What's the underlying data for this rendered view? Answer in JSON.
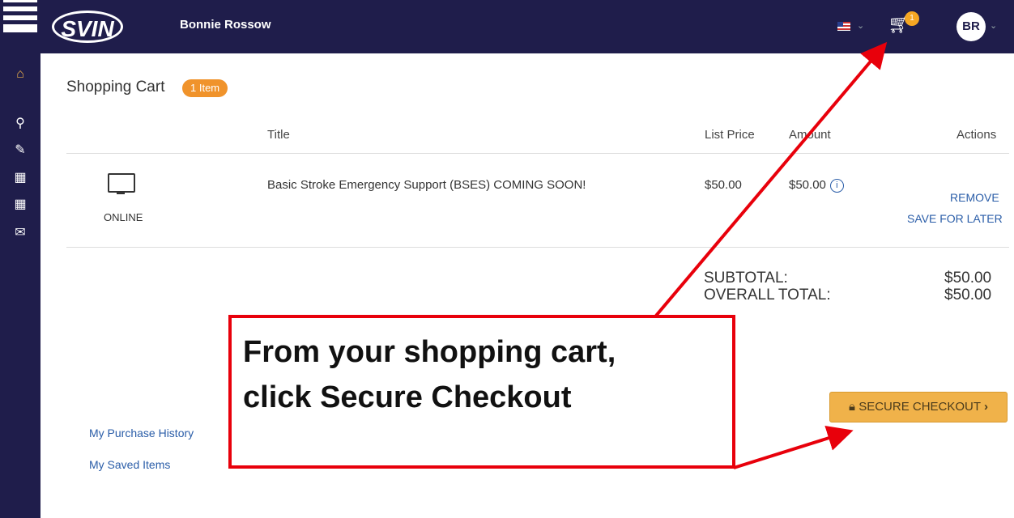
{
  "header": {
    "logo_text": "SVIN",
    "user_name": "Bonnie Rossow",
    "cart_count": "1",
    "avatar_initials": "BR"
  },
  "cart": {
    "title": "Shopping Cart",
    "item_count_badge": "1 Item",
    "columns": [
      "Title",
      "List Price",
      "Amount",
      "Actions"
    ],
    "item": {
      "format_label": "ONLINE",
      "title": "Basic Stroke Emergency Support (BSES) COMING SOON!",
      "list_price": "$50.00",
      "amount": "$50.00",
      "remove_label": "REMOVE",
      "save_for_later_label": "SAVE FOR LATER"
    },
    "subtotal_label": "SUBTOTAL:",
    "subtotal_value": "$50.00",
    "overall_total_label": "OVERALL TOTAL:",
    "overall_total_value": "$50.00",
    "checkout_label": "SECURE CHECKOUT"
  },
  "links": {
    "purchase_history": "My Purchase History",
    "saved_items": "My Saved Items"
  },
  "callout": {
    "line1": "From your shopping cart,",
    "line2": "click Secure Checkout"
  },
  "colors": {
    "nav_bg": "#1f1d4b",
    "badge": "#f0932b",
    "checkout_button": "#f0b24a",
    "link": "#2a5da8",
    "annotation_red": "#e8000b"
  }
}
